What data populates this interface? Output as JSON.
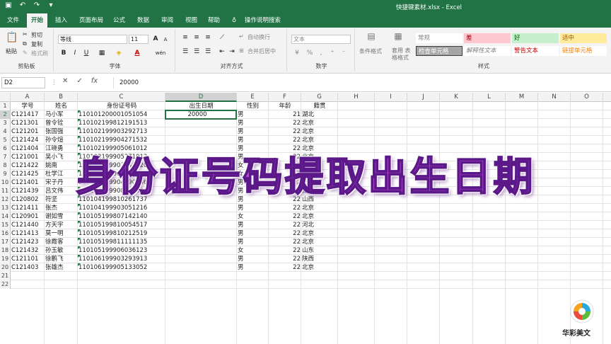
{
  "window": {
    "title": "快捷键素材.xlsx  -  Excel",
    "quick_access": [
      "save-icon",
      "undo-icon",
      "redo-icon",
      "customize-icon"
    ]
  },
  "tabs": [
    "文件",
    "开始",
    "插入",
    "页面布局",
    "公式",
    "数据",
    "审阅",
    "视图",
    "帮助",
    "操作说明搜索"
  ],
  "active_tab": "开始",
  "ribbon": {
    "clipboard": {
      "label": "剪贴板",
      "paste": "粘贴",
      "cut": "剪切",
      "copy": "复制",
      "format_painter": "格式刷"
    },
    "font": {
      "label": "字体",
      "name": "等线",
      "size": "11",
      "bold": "B",
      "italic": "I",
      "underline": "U",
      "grow": "A",
      "shrink": "A",
      "color_a": "A",
      "wen": "wén"
    },
    "alignment": {
      "label": "对齐方式",
      "wrap": "自动换行",
      "merge": "合并后居中"
    },
    "number": {
      "label": "数字",
      "format": "文本",
      "percent": "%",
      "comma": ","
    },
    "styles": {
      "label": "样式",
      "conditional": "条件格式",
      "table": "套用\n表格格式",
      "items": [
        "常规",
        "差",
        "好",
        "适中",
        "检查单元格",
        "解释性文本",
        "警告文本",
        "链接单元格"
      ]
    },
    "colors": {
      "bad_bg": "#ffc7ce",
      "good_bg": "#c6efce",
      "neutral_bg": "#ffeb9c",
      "check_bg": "#a5a5a5"
    }
  },
  "formula_bar": {
    "cell_ref": "D2",
    "value": "20000",
    "fx": "fx"
  },
  "columns": [
    "A",
    "B",
    "C",
    "D",
    "E",
    "F",
    "G",
    "H",
    "I",
    "J",
    "K",
    "L",
    "M",
    "N",
    "O"
  ],
  "selected_column": "D",
  "rows_count": 22,
  "header_row": [
    "学号",
    "姓名",
    "身份证号码",
    "出生日期",
    "性别",
    "年龄",
    "籍贯"
  ],
  "data_rows": [
    [
      "C121417",
      "马小军",
      "110101200001051054",
      "20000",
      "男",
      "21",
      "湖北"
    ],
    [
      "C121301",
      "曾令铨",
      "110102199812191513",
      "",
      "男",
      "22",
      "北京"
    ],
    [
      "C121201",
      "张国强",
      "110102199903292713",
      "",
      "男",
      "22",
      "北京"
    ],
    [
      "C121424",
      "孙令煊",
      "110102199904271532",
      "",
      "男",
      "22",
      "北京"
    ],
    [
      "C121404",
      "江晓勇",
      "110102199905061012",
      "",
      "男",
      "22",
      "北京"
    ],
    [
      "C121001",
      "吴小飞",
      "110102199905271012",
      "",
      "男",
      "22",
      "北京"
    ],
    [
      "C121422",
      "姚南",
      "110103199903040920",
      "",
      "女",
      "22",
      "北京"
    ],
    [
      "C121425",
      "杜学江",
      "110103199903270623",
      "",
      "女",
      "22",
      "北京"
    ],
    [
      "C121401",
      "宋子丹",
      "110103199904290936",
      "",
      "男",
      "22",
      "北京"
    ],
    [
      "C121439",
      "吕文伟",
      "110103199908080031",
      "",
      "男",
      "22",
      "湖南"
    ],
    [
      "C120802",
      "符坚",
      "110104199810261737",
      "",
      "男",
      "22",
      "山西"
    ],
    [
      "C121411",
      "张杰",
      "110104199903051216",
      "",
      "男",
      "22",
      "北京"
    ],
    [
      "C120901",
      "谢如雪",
      "110105199807142140",
      "",
      "女",
      "22",
      "北京"
    ],
    [
      "C121440",
      "方天宇",
      "110105199810054517",
      "",
      "男",
      "22",
      "河北"
    ],
    [
      "C121413",
      "莫一明",
      "110105199810212519",
      "",
      "男",
      "22",
      "北京"
    ],
    [
      "C121423",
      "徐霞客",
      "110105199811111135",
      "",
      "男",
      "22",
      "北京"
    ],
    [
      "C121432",
      "孙玉敏",
      "110105199906036123",
      "",
      "女",
      "22",
      "山东"
    ],
    [
      "C121101",
      "徐鹏飞",
      "110106199903293913",
      "",
      "男",
      "22",
      "陕西"
    ],
    [
      "C121403",
      "张雄杰",
      "110106199905133052",
      "",
      "男",
      "22",
      "北京"
    ]
  ],
  "banner_text": "身份证号码提取出生日期",
  "watermark": {
    "text": "华彩美文"
  }
}
